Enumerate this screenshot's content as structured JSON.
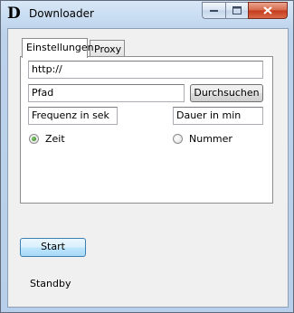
{
  "window": {
    "title": "Downloader",
    "icon_letter": "D"
  },
  "tabs": [
    {
      "label": "Einstellungen",
      "active": true
    },
    {
      "label": "Proxy",
      "active": false
    }
  ],
  "settings": {
    "url_value": "http://",
    "path_value": "Pfad",
    "browse_label": "Durchsuchen",
    "frequency_value": "Frequenz in sek",
    "duration_value": "Dauer in min",
    "radio_time_label": "Zeit",
    "radio_time_checked": true,
    "radio_number_label": "Nummer",
    "radio_number_checked": false
  },
  "actions": {
    "start_label": "Start"
  },
  "status": {
    "text": "Standby"
  }
}
